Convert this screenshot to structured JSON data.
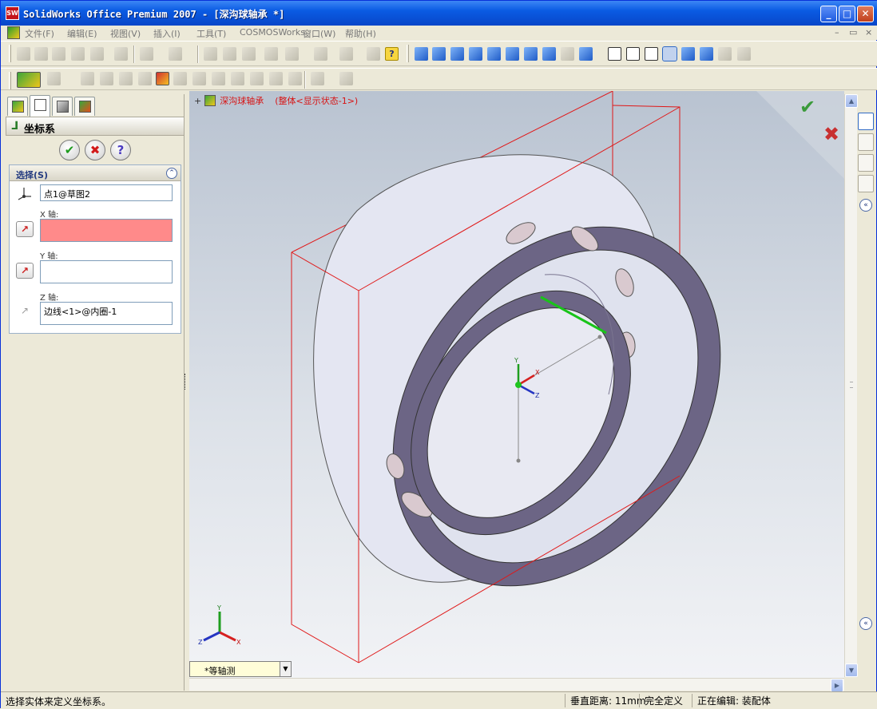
{
  "window": {
    "title": "SolidWorks Office Premium 2007 - [深沟球轴承 *]",
    "app_icon_text": "SW",
    "minimize": "_",
    "maximize": "□",
    "close": "✕"
  },
  "menu": {
    "items": [
      "文件(F)",
      "编辑(E)",
      "视图(V)",
      "插入(I)",
      "工具(T)",
      "COSMOSWorks",
      "窗口(W)",
      "帮助(H)"
    ],
    "mdi_buttons": [
      "–",
      "▭",
      "×"
    ]
  },
  "property_manager": {
    "title": "坐标系",
    "title_icon": "coordinate-system-icon",
    "ok_glyph": "✔",
    "cancel_glyph": "✖",
    "help_glyph": "?",
    "selection_group": {
      "label": "选择(S)",
      "collapse_glyph": "⌃",
      "origin_value": "点1@草图2",
      "x_axis_label": "X 轴:",
      "x_axis_value": "",
      "y_axis_label": "Y 轴:",
      "y_axis_value": "",
      "z_axis_label": "Z 轴:",
      "z_axis_value": "边线<1>@内圈-1",
      "pick_glyph": "↗"
    },
    "colors": {
      "active_field": "#ff8a8a"
    }
  },
  "graphics": {
    "tree_expand": "+",
    "tree_name": "深沟球轴承",
    "tree_config": "(整体<显示状态-1>)",
    "view_orientation": "*等轴测",
    "triad_labels": {
      "x": "X",
      "y": "Y",
      "z": "Z"
    },
    "confirm_ok": "✔",
    "confirm_cancel": "✖",
    "colors": {
      "bounding_box": "#e01818",
      "ring_face": "#6c6585",
      "ring_outer": "#e4e6f2",
      "selected_edge": "#19c419"
    }
  },
  "status": {
    "message": "选择实体来定义坐标系。",
    "distance": "垂直距离: 11mm",
    "definition": "完全定义",
    "editing": "正在编辑: 装配体"
  }
}
